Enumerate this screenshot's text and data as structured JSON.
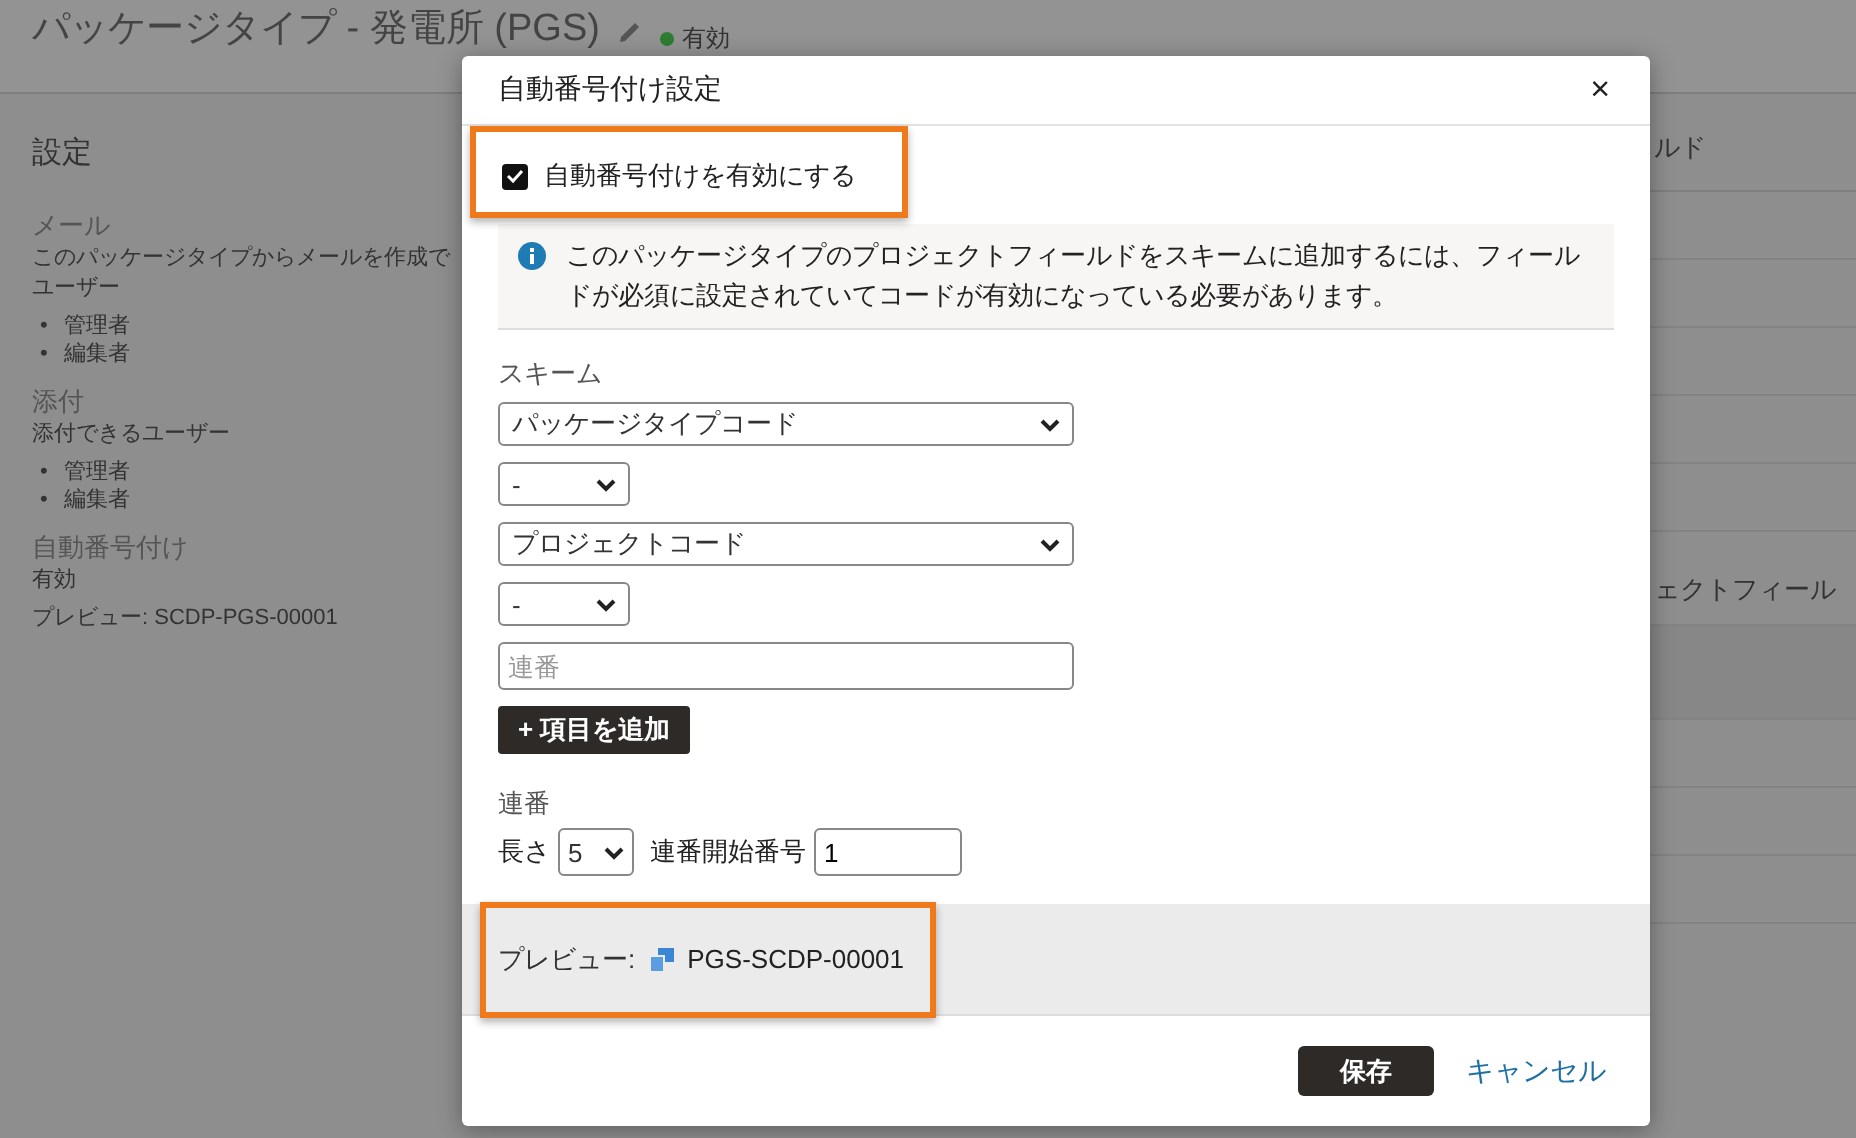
{
  "page": {
    "title": "パッケージタイプ - 発電所 (PGS)",
    "status": "有効"
  },
  "settings": {
    "heading": "設定",
    "sections": [
      {
        "label": "メール",
        "lines": [
          "このパッケージタイプからメールを作成で",
          "ユーザー"
        ],
        "items": [
          {
            "marker": "•",
            "text": "管理者"
          },
          {
            "marker": "•",
            "text": "編集者"
          }
        ]
      },
      {
        "label": "添付",
        "lines": [
          "添付できるユーザー"
        ],
        "items": [
          {
            "marker": "•",
            "text": "管理者"
          },
          {
            "marker": "•",
            "text": "編集者"
          }
        ]
      },
      {
        "label": "自動番号付け",
        "lines": [
          "有効",
          "プレビュー: SCDP-PGS-00001"
        ]
      }
    ]
  },
  "right_panel": {
    "heading": "ルド",
    "subheading": "ェクトフィール"
  },
  "dialog": {
    "title": "自動番号付け設定",
    "close": "×",
    "enable": {
      "label": "自動番号付けを有効にする",
      "checked": true,
      "highlighted": true
    },
    "info": "このパッケージタイプのプロジェクトフィールドをスキームに追加するには、フィールドが必須に設定されていてコードが有効になっている必要があります。",
    "scheme": {
      "label": "スキーム",
      "parts": [
        {
          "kind": "field",
          "value": "パッケージタイプコード"
        },
        {
          "kind": "separator",
          "value": "-"
        },
        {
          "kind": "field",
          "value": "プロジェクトコード"
        },
        {
          "kind": "separator",
          "value": "-"
        },
        {
          "kind": "sequence",
          "placeholder": "連番"
        }
      ]
    },
    "add_button": "+ 項目を追加",
    "sequence": {
      "label": "連番",
      "length_label": "長さ",
      "length": "5",
      "start_label": "連番開始番号",
      "start": "1"
    },
    "preview": {
      "label": "プレビュー:",
      "value": "PGS-SCDP-00001",
      "highlighted": true
    },
    "save": "保存",
    "cancel": "キャンセル"
  }
}
